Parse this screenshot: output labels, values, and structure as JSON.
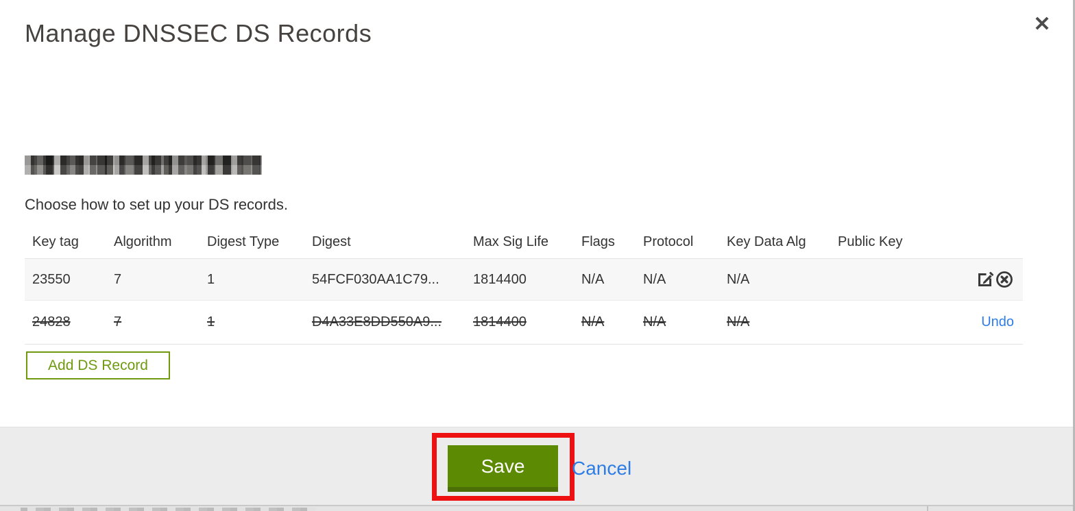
{
  "modal": {
    "title": "Manage DNSSEC DS Records",
    "close_glyph": "✕",
    "instruction": "Choose how to set up your DS records.",
    "table": {
      "columns": [
        "Key tag",
        "Algorithm",
        "Digest Type",
        "Digest",
        "Max Sig Life",
        "Flags",
        "Protocol",
        "Key Data Alg",
        "Public Key"
      ],
      "rows": [
        {
          "key_tag": "23550",
          "algorithm": "7",
          "digest_type": "1",
          "digest": "54FCF030AA1C79...",
          "max_sig_life": "1814400",
          "flags": "N/A",
          "protocol": "N/A",
          "key_data_alg": "N/A",
          "public_key": "",
          "state": "active"
        },
        {
          "key_tag": "24828",
          "algorithm": "7",
          "digest_type": "1",
          "digest": "D4A33E8DD550A9...",
          "max_sig_life": "1814400",
          "flags": "N/A",
          "protocol": "N/A",
          "key_data_alg": "N/A",
          "public_key": "",
          "state": "deleted",
          "undo_label": "Undo"
        }
      ]
    },
    "add_button_label": "Add DS Record",
    "footer": {
      "save_label": "Save",
      "cancel_label": "Cancel"
    }
  },
  "icons": {
    "edit": "edit-icon",
    "delete": "circle-x-icon",
    "close": "close-icon"
  },
  "colors": {
    "accent_green_outline": "#6f9a10",
    "save_button_green": "#5d8a03",
    "save_button_green_dark": "#4c7007",
    "link_blue": "#2e7de5",
    "annotation_red": "#ee1111",
    "footer_gray": "#ececec",
    "row_alt_gray": "#f7f7f7",
    "text_dark": "#333333"
  }
}
